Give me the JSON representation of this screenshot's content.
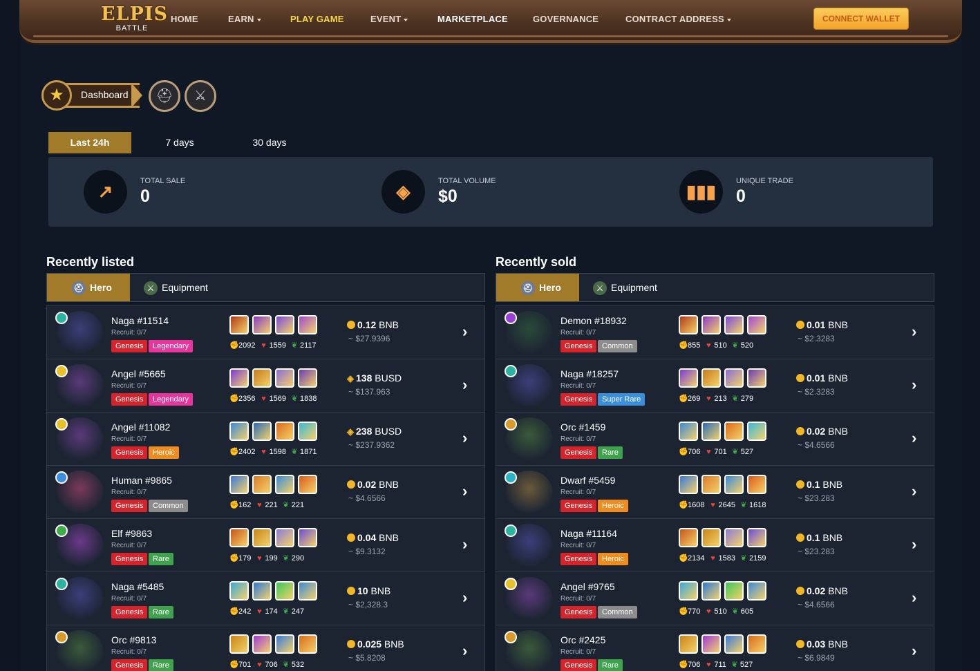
{
  "brand": {
    "name": "ELPIS",
    "sub": "BATTLE"
  },
  "nav": {
    "home": "HOME",
    "earn": "EARN",
    "play_game": "PLAY GAME",
    "event": "EVENT",
    "marketplace": "MARKETPLACE",
    "governance": "GOVERNANCE",
    "contract_address": "CONTRACT ADDRESS",
    "connect_wallet": "CONNECT WALLET"
  },
  "breadcrumb": {
    "dashboard": "Dashboard"
  },
  "time_tabs": [
    "Last 24h",
    "7 days",
    "30 days"
  ],
  "stats": {
    "total_sale": {
      "label": "TOTAL SALE",
      "value": "0"
    },
    "total_volume": {
      "label": "TOTAL VOLUME",
      "value": "$0"
    },
    "unique_trade": {
      "label": "UNIQUE TRADE",
      "value": "0"
    }
  },
  "recently_listed": {
    "title": "Recently listed",
    "tabs": {
      "hero": "Hero",
      "equipment": "Equipment"
    },
    "rows": [
      {
        "name": "Naga #11514",
        "recruit": "Recruit: 0/7",
        "edition": "Genesis",
        "rarity": "Legendary",
        "atk": "2092",
        "hp": "1559",
        "def": "2117",
        "price": "0.12",
        "currency": "BNB",
        "usd": "~ $27.9396"
      },
      {
        "name": "Angel #5665",
        "recruit": "Recruit: 0/7",
        "edition": "Genesis",
        "rarity": "Legendary",
        "atk": "2356",
        "hp": "1569",
        "def": "1838",
        "price": "138",
        "currency": "BUSD",
        "usd": "~ $137.963"
      },
      {
        "name": "Angel #11082",
        "recruit": "Recruit: 0/7",
        "edition": "Genesis",
        "rarity": "Heroic",
        "atk": "2402",
        "hp": "1598",
        "def": "1871",
        "price": "238",
        "currency": "BUSD",
        "usd": "~ $237.9362"
      },
      {
        "name": "Human #9865",
        "recruit": "Recruit: 0/7",
        "edition": "Genesis",
        "rarity": "Common",
        "atk": "162",
        "hp": "221",
        "def": "221",
        "price": "0.02",
        "currency": "BNB",
        "usd": "~ $4.6566"
      },
      {
        "name": "Elf #9863",
        "recruit": "Recruit: 0/7",
        "edition": "Genesis",
        "rarity": "Rare",
        "atk": "179",
        "hp": "199",
        "def": "290",
        "price": "0.04",
        "currency": "BNB",
        "usd": "~ $9.3132"
      },
      {
        "name": "Naga #5485",
        "recruit": "Recruit: 0/7",
        "edition": "Genesis",
        "rarity": "Rare",
        "atk": "242",
        "hp": "174",
        "def": "247",
        "price": "10",
        "currency": "BNB",
        "usd": "~ $2,328.3"
      },
      {
        "name": "Orc #9813",
        "recruit": "Recruit: 0/7",
        "edition": "Genesis",
        "rarity": "Rare",
        "atk": "701",
        "hp": "706",
        "def": "532",
        "price": "0.025",
        "currency": "BNB",
        "usd": "~ $5.8208"
      }
    ]
  },
  "recently_sold": {
    "title": "Recently sold",
    "tabs": {
      "hero": "Hero",
      "equipment": "Equipment"
    },
    "rows": [
      {
        "name": "Demon #18932",
        "recruit": "Recruit: 0/7",
        "edition": "Genesis",
        "rarity": "Common",
        "atk": "855",
        "hp": "510",
        "def": "520",
        "price": "0.01",
        "currency": "BNB",
        "usd": "~ $2.3283"
      },
      {
        "name": "Naga #18257",
        "recruit": "Recruit: 0/7",
        "edition": "Genesis",
        "rarity": "Super Rare",
        "atk": "269",
        "hp": "213",
        "def": "279",
        "price": "0.01",
        "currency": "BNB",
        "usd": "~ $2.3283"
      },
      {
        "name": "Orc #1459",
        "recruit": "Recruit: 0/7",
        "edition": "Genesis",
        "rarity": "Rare",
        "atk": "706",
        "hp": "701",
        "def": "527",
        "price": "0.02",
        "currency": "BNB",
        "usd": "~ $4.6566"
      },
      {
        "name": "Dwarf #5459",
        "recruit": "Recruit: 0/7",
        "edition": "Genesis",
        "rarity": "Heroic",
        "atk": "1608",
        "hp": "2645",
        "def": "1618",
        "price": "0.1",
        "currency": "BNB",
        "usd": "~ $23.283"
      },
      {
        "name": "Naga #11164",
        "recruit": "Recruit: 0/7",
        "edition": "Genesis",
        "rarity": "Heroic",
        "atk": "2134",
        "hp": "1583",
        "def": "2159",
        "price": "0.1",
        "currency": "BNB",
        "usd": "~ $23.283"
      },
      {
        "name": "Angel #9765",
        "recruit": "Recruit: 0/7",
        "edition": "Genesis",
        "rarity": "Common",
        "atk": "770",
        "hp": "510",
        "def": "605",
        "price": "0.02",
        "currency": "BNB",
        "usd": "~ $4.6566"
      },
      {
        "name": "Orc #2425",
        "recruit": "Recruit: 0/7",
        "edition": "Genesis",
        "rarity": "Rare",
        "atk": "706",
        "hp": "711",
        "def": "527",
        "price": "0.03",
        "currency": "BNB",
        "usd": "~ $6.9849"
      }
    ]
  },
  "colors": {
    "accent_gold": "#a17a2a",
    "genesis": "#d8232a",
    "legendary": "#e8359c",
    "heroic": "#f08c1e",
    "common": "#8c8c8c",
    "rare": "#3fa34d",
    "super_rare": "#3a8fdc"
  }
}
